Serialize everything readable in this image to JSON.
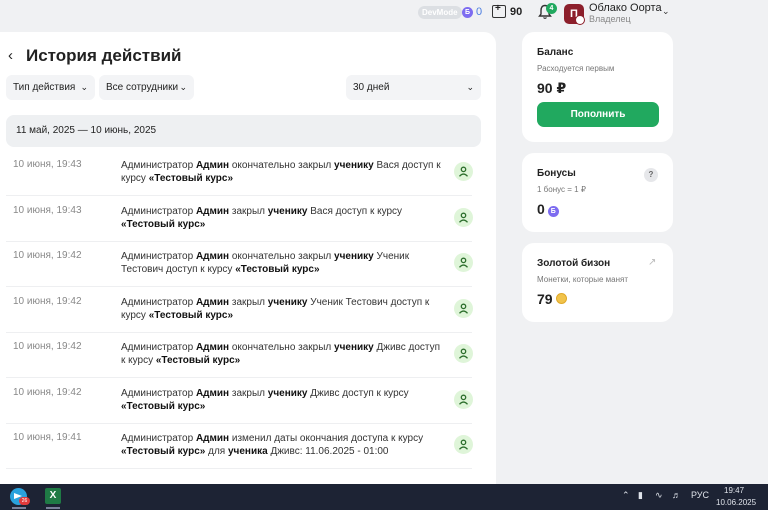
{
  "topbar": {
    "devmode": "DevMode",
    "bonus_letter": "Б",
    "bonus_count": "0",
    "balance_count": "90",
    "notif_count": "4",
    "avatar_letter": "П",
    "org_name": "Облако Оорта",
    "org_role": "Владелец"
  },
  "history": {
    "title": "История действий",
    "filters": {
      "action_type": "Тип действия",
      "employees": "Все сотрудники",
      "period": "30 дней"
    },
    "date_range": "11 май, 2025 — 10 июнь, 2025",
    "rows": [
      {
        "time": "10 июня, 19:43",
        "parts": [
          "Администратор ",
          "Админ",
          " окончательно закрыл ",
          "ученику",
          " Вася доступ к курсу ",
          "«Тестовый курс»",
          ""
        ]
      },
      {
        "time": "10 июня, 19:43",
        "parts": [
          "Администратор ",
          "Админ",
          " закрыл ",
          "ученику",
          " Вася доступ к курсу ",
          "«Тестовый курс»",
          ""
        ]
      },
      {
        "time": "10 июня, 19:42",
        "parts": [
          "Администратор ",
          "Админ",
          " окончательно закрыл ",
          "ученику",
          " Ученик Тестович доступ к курсу ",
          "«Тестовый курс»",
          ""
        ]
      },
      {
        "time": "10 июня, 19:42",
        "parts": [
          "Администратор ",
          "Админ",
          " закрыл ",
          "ученику",
          " Ученик Тестович доступ к курсу ",
          "«Тестовый курс»",
          ""
        ]
      },
      {
        "time": "10 июня, 19:42",
        "parts": [
          "Администратор ",
          "Админ",
          " окончательно закрыл ",
          "ученику",
          " Дживс доступ к курсу ",
          "«Тестовый курс»",
          ""
        ]
      },
      {
        "time": "10 июня, 19:42",
        "parts": [
          "Администратор ",
          "Админ",
          " закрыл ",
          "ученику",
          " Дживс доступ к курсу ",
          "«Тестовый курс»",
          ""
        ]
      },
      {
        "time": "10 июня, 19:41",
        "parts": [
          "Администратор ",
          "Админ",
          " изменил даты окончания доступа к курсу ",
          "«Тестовый курс»",
          " для ",
          "ученика",
          " Дживс: 11.06.2025 - 01:00"
        ]
      }
    ]
  },
  "balance_card": {
    "title": "Баланс",
    "subtitle": "Расходуется первым",
    "value": "90 ₽",
    "topup_label": "Пополнить"
  },
  "bonus_card": {
    "title": "Бонусы",
    "help": "?",
    "subtitle": "1 бонус = 1 ₽",
    "value": "0",
    "coin_letter": "Б"
  },
  "bison_card": {
    "title": "Золотой бизон",
    "subtitle": "Монетки, которые манят",
    "value": "79"
  },
  "taskbar": {
    "tg_badge": "26",
    "excel_letter": "X",
    "lang": "РУС",
    "time": "19:47",
    "date": "10.06.2025"
  },
  "colors": {
    "accent": "#21a95f",
    "bonus": "#7d6cf0",
    "user_badge_bg": "#dff5d9"
  }
}
